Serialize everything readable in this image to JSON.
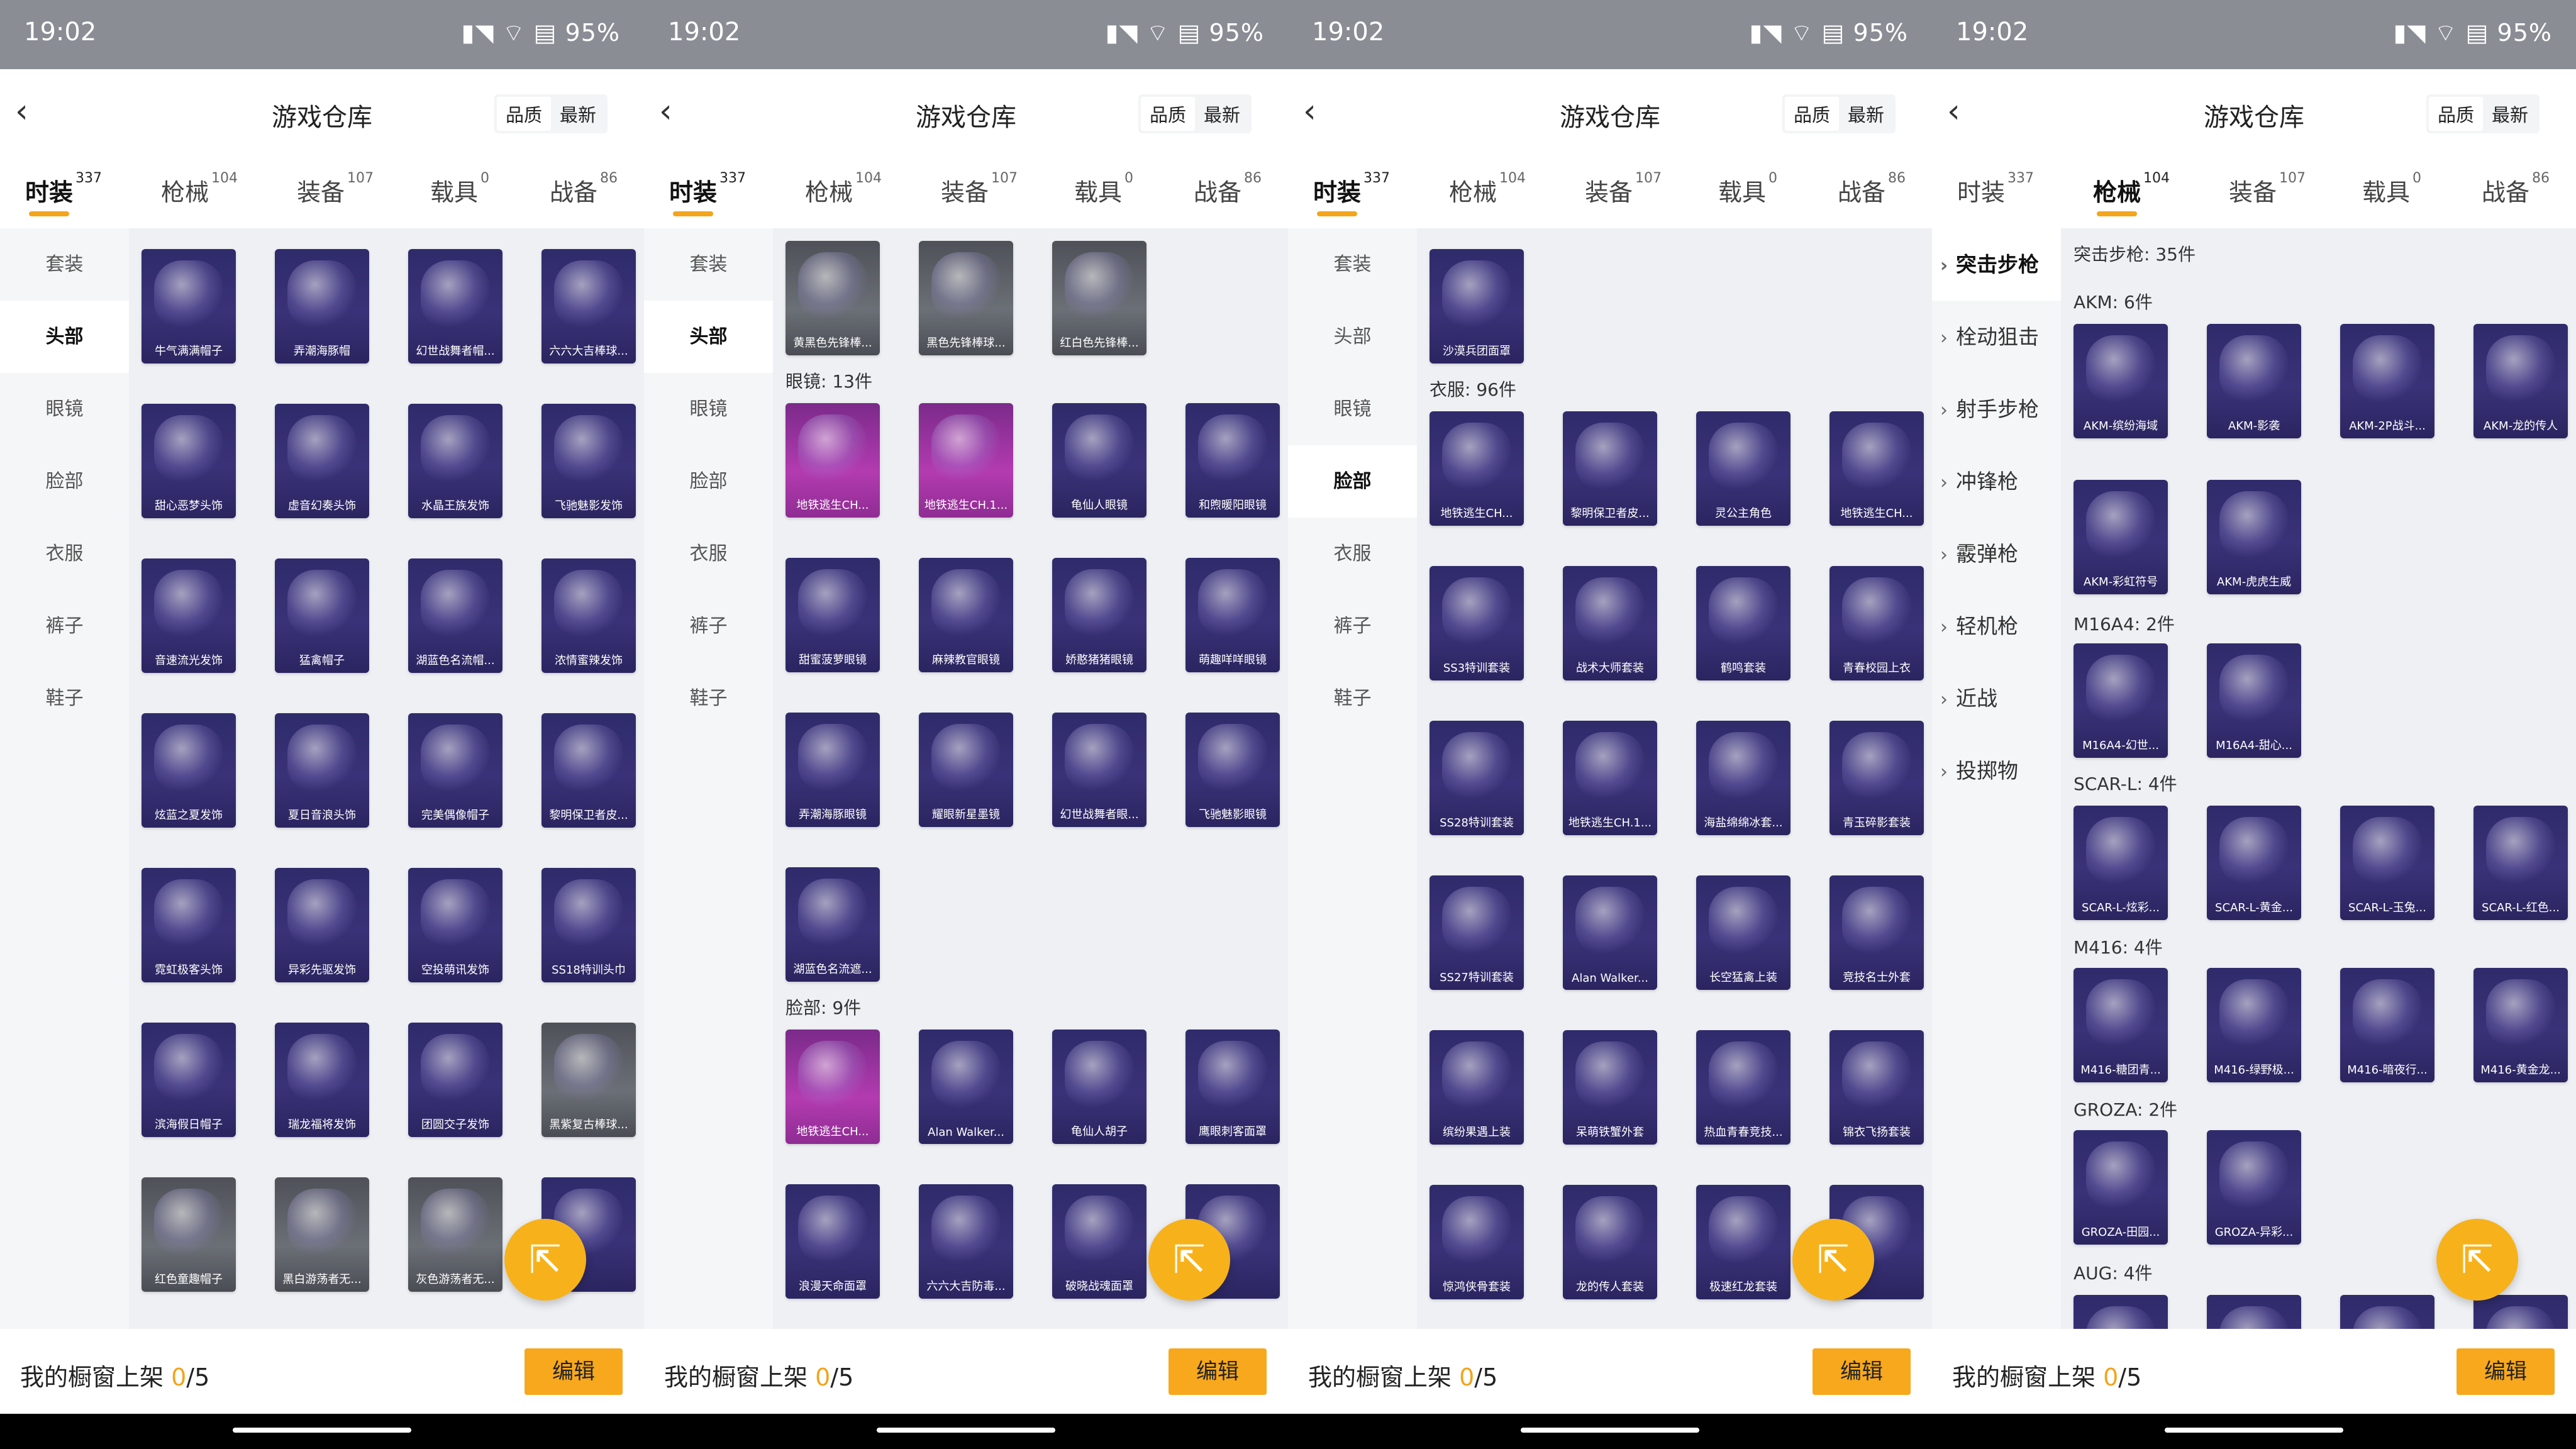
{
  "status": {
    "time": "19:02",
    "battery": "95%"
  },
  "header": {
    "title": "游戏仓库",
    "sort_quality": "品质",
    "sort_latest": "最新"
  },
  "tabs": [
    {
      "label": "时装",
      "count": "337"
    },
    {
      "label": "枪械",
      "count": "104"
    },
    {
      "label": "装备",
      "count": "107"
    },
    {
      "label": "载具",
      "count": "0"
    },
    {
      "label": "战备",
      "count": "86"
    }
  ],
  "fashion_side": [
    "套装",
    "头部",
    "眼镜",
    "脸部",
    "衣服",
    "裤子",
    "鞋子"
  ],
  "weapon_side": [
    "突击步枪",
    "栓动狙击",
    "射手步枪",
    "冲锋枪",
    "霰弹枪",
    "轻机枪",
    "近战",
    "投掷物"
  ],
  "bottom": {
    "label": "我的橱窗上架 ",
    "count": "0",
    "total": "/5",
    "edit": "编辑"
  },
  "panel1": {
    "items": [
      "牛气满满帽子",
      "弄潮海豚帽",
      "幻世战舞者帽...",
      "六六大吉棒球...",
      "甜心恶梦头饰",
      "虚音幻奏头饰",
      "水晶王族发饰",
      "飞驰魅影发饰",
      "音速流光发饰",
      "猛禽帽子",
      "湖蓝色名流帽...",
      "浓情蜜辣发饰",
      "炫蓝之夏发饰",
      "夏日音浪头饰",
      "完美偶像帽子",
      "黎明保卫者皮...",
      "霓虹极客头饰",
      "异彩先驱发饰",
      "空投萌讯发饰",
      "SS18特训头巾",
      "滨海假日帽子",
      "瑞龙福将发饰",
      "团圆交子发饰",
      "黑紫复古棒球...",
      "红色童趣帽子",
      "黑白游荡者无...",
      "灰色游荡者无...",
      ""
    ]
  },
  "panel2": {
    "top_items": [
      "黄黑色先锋棒...",
      "黑色先锋棒球...",
      "红白色先锋棒..."
    ],
    "glasses_header": "眼镜: 13件",
    "glasses": [
      "地铁逃生CH...",
      "地铁逃生CH.1...",
      "龟仙人眼镜",
      "和煦暖阳眼镜",
      "甜蜜菠萝眼镜",
      "麻辣教官眼镜",
      "娇憨猪猪眼镜",
      "萌趣咩咩眼镜",
      "弄潮海豚眼镜",
      "耀眼新星墨镜",
      "幻世战舞者眼...",
      "飞驰魅影眼镜",
      "湖蓝色名流遮..."
    ],
    "face_header": "脸部: 9件",
    "face": [
      "地铁逃生CH...",
      "Alan Walker...",
      "龟仙人胡子",
      "鹰眼刺客面罩",
      "浪漫天命面罩",
      "六六大吉防毒...",
      "破晓战魂面罩",
      ""
    ]
  },
  "panel3": {
    "top_items": [
      "沙漠兵团面罩"
    ],
    "clothes_header": "衣服: 96件",
    "clothes": [
      "地铁逃生CH...",
      "黎明保卫者皮...",
      "灵公主角色",
      "地铁逃生CH...",
      "SS3特训套装",
      "战术大师套装",
      "鹤鸣套装",
      "青春校园上衣",
      "SS28特训套装",
      "地铁逃生CH.1...",
      "海盐绵绵冰套...",
      "青玉碎影套装",
      "SS27特训套装",
      "Alan Walker...",
      "长空猛禽上装",
      "竞技名士外套",
      "缤纷果遇上装",
      "呆萌铁蟹外套",
      "热血青春竞技...",
      "锦衣飞扬套装",
      "惊鸿侠骨套装",
      "龙的传人套装",
      "极速红龙套装",
      ""
    ]
  },
  "panel4": {
    "ar_header": "突击步枪: 35件",
    "groups": [
      {
        "header": "AKM: 6件",
        "items": [
          "AKM-缤纷海域",
          "AKM-影袭",
          "AKM-2P战斗...",
          "AKM-龙的传人",
          "AKM-彩虹符号",
          "AKM-虎虎生威"
        ]
      },
      {
        "header": "M16A4: 2件",
        "items": [
          "M16A4-幻世...",
          "M16A4-甜心..."
        ]
      },
      {
        "header": "SCAR-L: 4件",
        "items": [
          "SCAR-L-炫彩...",
          "SCAR-L-黄金...",
          "SCAR-L-玉兔...",
          "SCAR-L-红色..."
        ]
      },
      {
        "header": "M416: 4件",
        "items": [
          "M416-糖团青...",
          "M416-绿野极...",
          "M416-暗夜行...",
          "M416-黄金龙..."
        ]
      },
      {
        "header": "GROZA: 2件",
        "items": [
          "GROZA-田园...",
          "GROZA-异彩..."
        ]
      },
      {
        "header": "AUG: 4件",
        "items": [
          "",
          "",
          "",
          ""
        ]
      }
    ]
  }
}
